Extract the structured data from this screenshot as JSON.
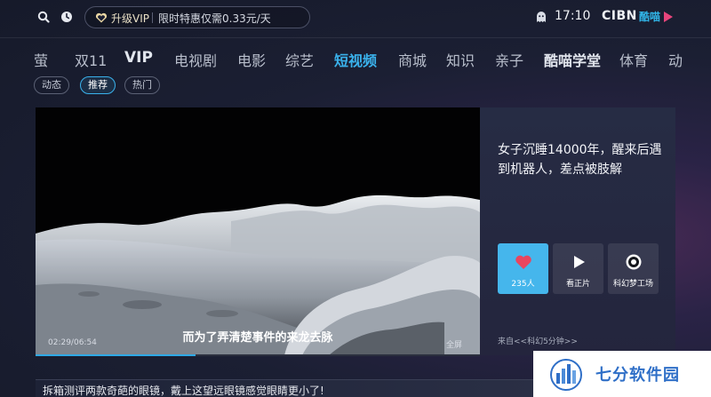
{
  "header": {
    "vip_label": "升级VIP",
    "vip_promo": "限时特惠仅需0.33元/天",
    "clock": "17:10",
    "cibn_logo": "CIBN",
    "kumiao_logo": "酷喵",
    "icons": [
      "search-icon",
      "history-icon",
      "vip-heart-icon",
      "ghost-icon",
      "play-logo-icon"
    ]
  },
  "nav": {
    "items": [
      {
        "label": "萤"
      },
      {
        "label": "双11"
      },
      {
        "label": "VIP"
      },
      {
        "label": "电视剧"
      },
      {
        "label": "电影"
      },
      {
        "label": "综艺"
      },
      {
        "label": "短视频"
      },
      {
        "label": "商城"
      },
      {
        "label": "知识"
      },
      {
        "label": "亲子"
      },
      {
        "label": "酷喵学堂"
      },
      {
        "label": "体育"
      },
      {
        "label": "动"
      }
    ],
    "active": "短视频"
  },
  "subtabs": {
    "items": [
      {
        "label": "动态"
      },
      {
        "label": "推荐"
      },
      {
        "label": "热门"
      }
    ],
    "active": "推荐"
  },
  "player": {
    "subtitle": "而为了弄清楚事件的来龙去脉",
    "timecode": "02:29/06:54",
    "fullscreen": "全屏",
    "progress": 0.36
  },
  "info": {
    "title": "女子沉睡14000年，醒来后遇到机器人，差点被肢解",
    "actions": [
      {
        "label": "235人",
        "icon": "heart-icon"
      },
      {
        "label": "看正片",
        "icon": "play-icon"
      },
      {
        "label": "科幻梦工场",
        "icon": "channel-avatar-icon"
      }
    ],
    "source": "来自<<科幻5分钟>>"
  },
  "next": {
    "title": "拆箱测评两款奇葩的眼镜，戴上这望远眼镜感觉眼睛更小了!"
  },
  "watermark": {
    "text": "七分软件园"
  },
  "colors": {
    "accent": "#3ab2ec",
    "like_tile": "#45b6ec",
    "background": "#1b1f33"
  }
}
